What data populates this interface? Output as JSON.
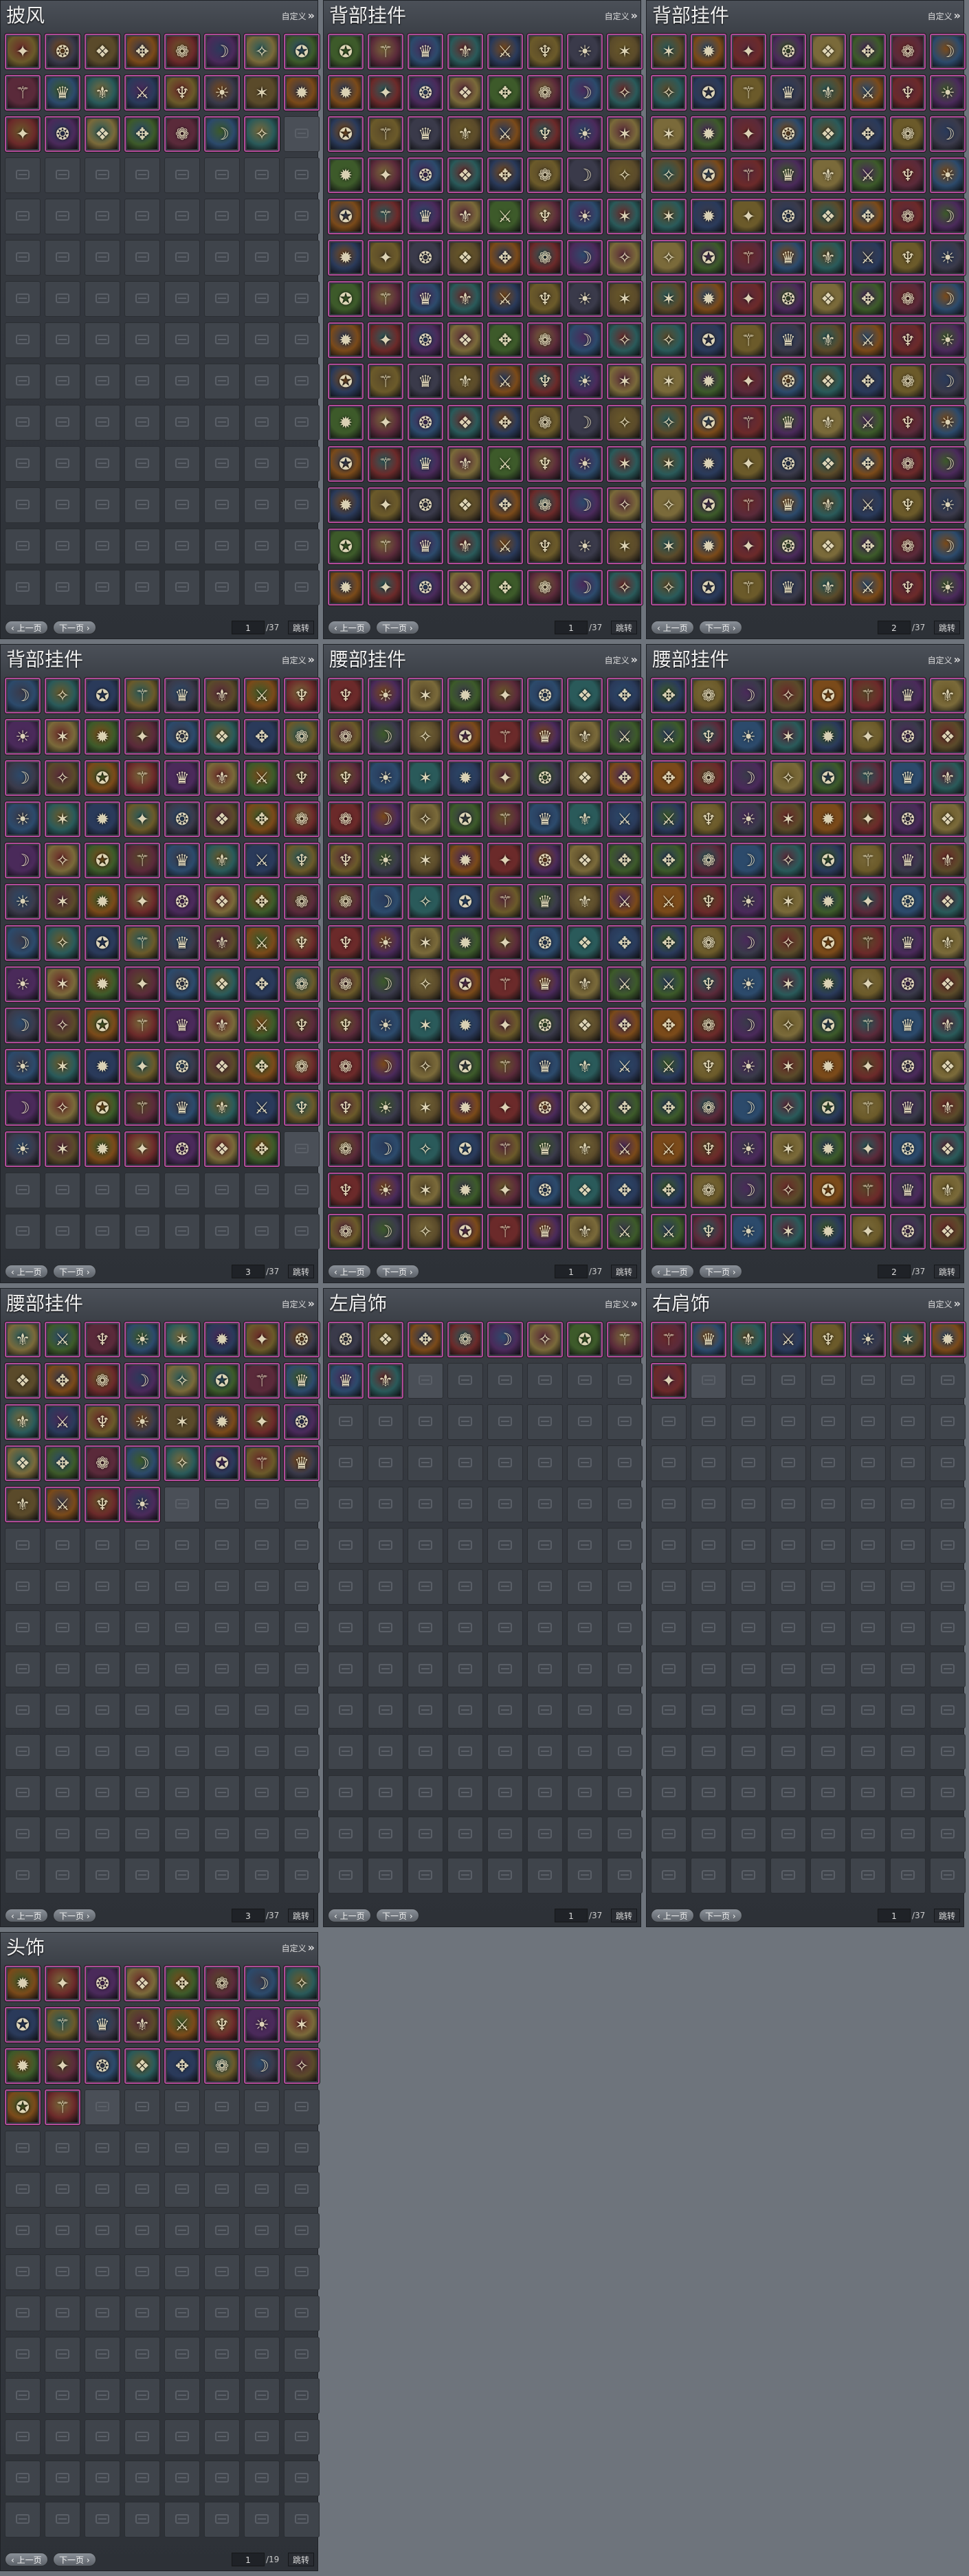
{
  "labels": {
    "customize": "自定义",
    "prev": "上一页",
    "next": "下一页",
    "go": "跳转"
  },
  "palette": [
    "#6b2a2a",
    "#2c4a6b",
    "#5a4a2a",
    "#3d5a2a",
    "#6b5a2a",
    "#4a2a5a",
    "#2a5a5a",
    "#7a4a1a",
    "#5a2a3a",
    "#3a3a4a",
    "#7a6a3a",
    "#2a3a5a"
  ],
  "glyphs": [
    "✦",
    "⚔",
    "✧",
    "❂",
    "♆",
    "✪",
    "❖",
    "☀",
    "⚚",
    "✥",
    "✶",
    "♛",
    "❁",
    "✹",
    "⚜",
    "☽"
  ],
  "panels": [
    {
      "title": "披风",
      "filled": 23,
      "page": "1",
      "total": "/37"
    },
    {
      "title": "背部挂件",
      "filled": 112,
      "page": "1",
      "total": "/37"
    },
    {
      "title": "背部挂件",
      "filled": 112,
      "page": "2",
      "total": "/37"
    },
    {
      "title": "背部挂件",
      "filled": 95,
      "page": "3",
      "total": "/37"
    },
    {
      "title": "腰部挂件",
      "filled": 112,
      "page": "1",
      "total": "/37"
    },
    {
      "title": "腰部挂件",
      "filled": 112,
      "page": "2",
      "total": "/37"
    },
    {
      "title": "腰部挂件",
      "filled": 36,
      "page": "3",
      "total": "/37"
    },
    {
      "title": "左肩饰",
      "filled": 10,
      "page": "1",
      "total": "/37"
    },
    {
      "title": "右肩饰",
      "filled": 9,
      "page": "1",
      "total": "/37"
    },
    {
      "title": "头饰",
      "filled": 26,
      "page": "1",
      "total": "/19"
    }
  ]
}
